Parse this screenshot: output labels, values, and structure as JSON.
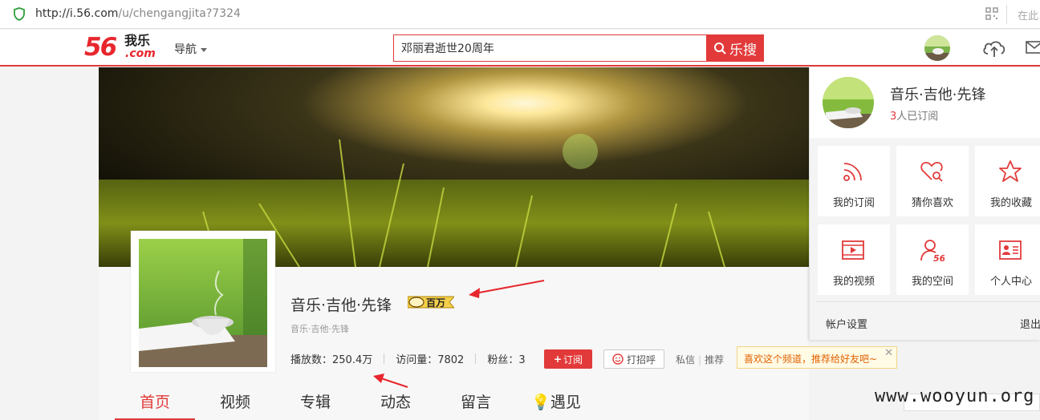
{
  "browser": {
    "url_host": "http://i.56.com",
    "url_path": "/u/chengangjita?7324",
    "right_text": "在此"
  },
  "header": {
    "logo_number": "56",
    "logo_text": "我乐",
    "logo_domain": ".com",
    "nav_label": "导航",
    "search_value": "邓丽君逝世20周年",
    "search_button": "乐搜"
  },
  "profile": {
    "name": "音乐·吉他·先锋",
    "badge_text": "百万",
    "subtitle": "音乐·吉他·先锋",
    "stats": [
      {
        "label": "播放数：250.4万"
      },
      {
        "label": "访问量：7802"
      },
      {
        "label": "粉丝：3"
      }
    ],
    "subscribe_button": "订阅",
    "greet_button": "打招呼",
    "message_link": "私信",
    "recommend_link": "推荐",
    "tip_text": "喜欢这个频道，推荐给好友吧~"
  },
  "tabs": [
    "首页",
    "视频",
    "专辑",
    "动态",
    "留言",
    "遇见"
  ],
  "panel": {
    "name": "音乐·吉他·先锋",
    "sub_count": "3",
    "sub_suffix": "人已订阅",
    "tiles": [
      {
        "label": "我的订阅",
        "icon": "rss-icon"
      },
      {
        "label": "猜你喜欢",
        "icon": "heart-search-icon"
      },
      {
        "label": "我的收藏",
        "icon": "star-icon"
      },
      {
        "label": "我的视频",
        "icon": "video-icon"
      },
      {
        "label": "我的空间",
        "icon": "user-56-icon"
      },
      {
        "label": "个人中心",
        "icon": "profile-card-icon"
      }
    ],
    "account_settings": "帐户设置",
    "logout": "退出"
  },
  "watermark": "www.wooyun.org",
  "colors": {
    "accent": "#e23a3a",
    "tip_text": "#e06000"
  }
}
